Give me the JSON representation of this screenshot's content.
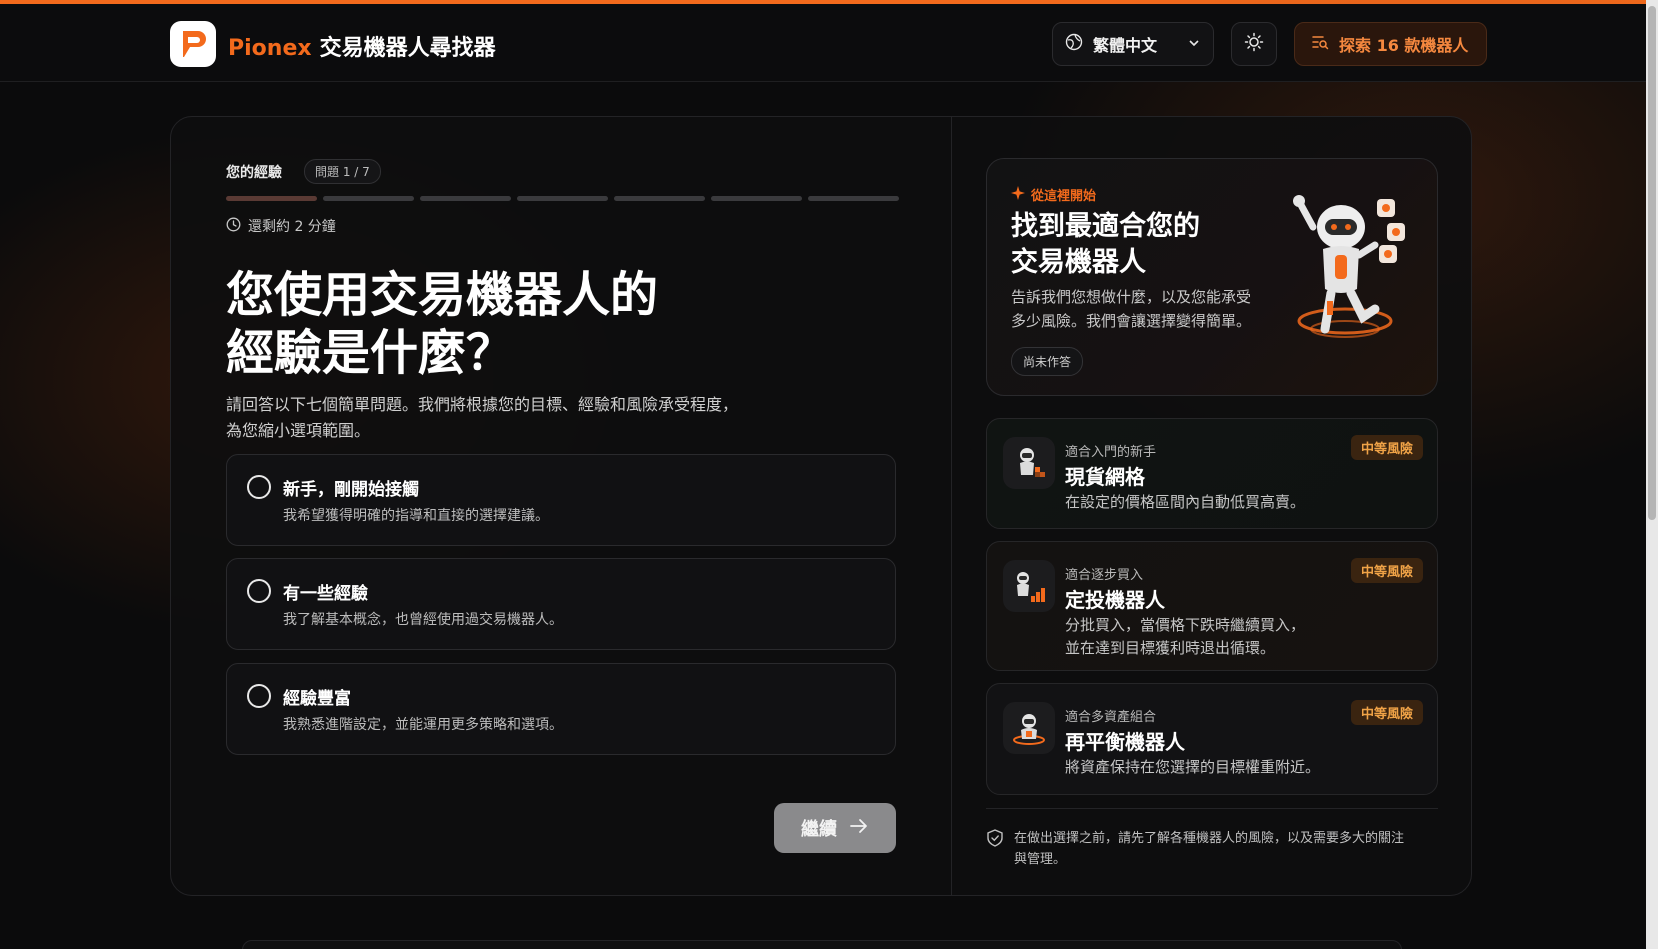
{
  "header": {
    "brand": "Pionex",
    "title": "交易機器人尋找器",
    "language": "繁體中文",
    "explore_label": "探索 16 款機器人",
    "icons": [
      "pionex-logo",
      "globe-icon",
      "chevron-down-icon",
      "sun-icon",
      "list-search-icon"
    ]
  },
  "question": {
    "step_label": "您的經驗",
    "step_badge": "問題 1 / 7",
    "progress": {
      "current": 1,
      "total": 7
    },
    "time_remaining": "還剩約 2 分鐘",
    "title_line1": "您使用交易機器人的",
    "title_line2": "經驗是什麼？",
    "desc_line1": "請回答以下七個簡單問題。我們將根據您的目標、經驗和風險承受程度，",
    "desc_line2": "為您縮小選項範圍。",
    "options": [
      {
        "title": "新手，剛開始接觸",
        "desc": "我希望獲得明確的指導和直接的選擇建議。"
      },
      {
        "title": "有一些經驗",
        "desc": "我了解基本概念，也曾經使用過交易機器人。"
      },
      {
        "title": "經驗豐富",
        "desc": "我熟悉進階設定，並能運用更多策略和選項。"
      }
    ],
    "continue_label": "繼續"
  },
  "hero": {
    "tag": "從這裡開始",
    "title_line1": "找到最適合您的",
    "title_line2": "交易機器人",
    "desc_line1": "告訴我們您想做什麼，以及您能承受",
    "desc_line2": "多少風險。我們會讓選擇變得簡單。",
    "status": "尚未作答"
  },
  "bots": [
    {
      "subtitle": "適合入門的新手",
      "name": "現貨網格",
      "desc_line1": "在設定的價格區間內自動低買高賣。",
      "desc_line2": "",
      "risk": "中等風險"
    },
    {
      "subtitle": "適合逐步買入",
      "name": "定投機器人",
      "desc_line1": "分批買入，當價格下跌時繼續買入，",
      "desc_line2": "並在達到目標獲利時退出循環。",
      "risk": "中等風險"
    },
    {
      "subtitle": "適合多資產組合",
      "name": "再平衡機器人",
      "desc_line1": "將資產保持在您選擇的目標權重附近。",
      "desc_line2": "",
      "risk": "中等風險"
    }
  ],
  "disclaimer": {
    "line1": "在做出選擇之前，請先了解各種機器人的風險，以及需要多大的關注",
    "line2": "與管理。"
  },
  "colors": {
    "accent": "#f36a1c",
    "risk": "#f0a347",
    "background": "#0b0b0c"
  }
}
